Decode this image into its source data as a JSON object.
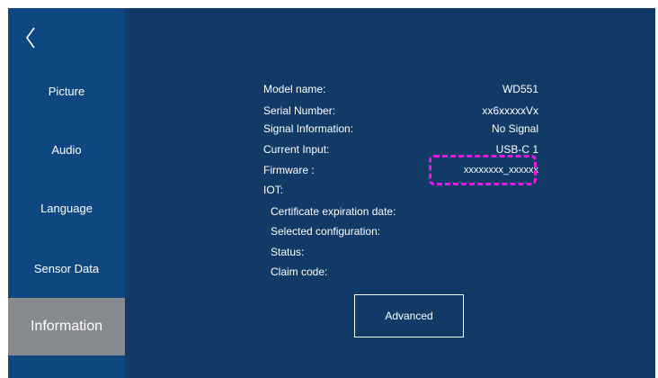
{
  "sidebar": {
    "back_icon": "chevron-left-icon",
    "items": [
      {
        "label": "Picture"
      },
      {
        "label": "Audio"
      },
      {
        "label": "Language"
      },
      {
        "label": "Sensor Data"
      },
      {
        "label": "Information",
        "active": true
      }
    ]
  },
  "info": {
    "model_name": {
      "label": "Model name:",
      "value": "WD551"
    },
    "serial_number": {
      "label": "Serial Number:",
      "value": "xx6xxxxxVx"
    },
    "signal_information": {
      "label": "Signal Information:",
      "value": "No Signal"
    },
    "current_input": {
      "label": "Current Input:",
      "value": "USB-C 1"
    },
    "firmware": {
      "label": "Firmware :",
      "value": "xxxxxxxx_xxxxxx"
    },
    "iot": {
      "label": "IOT:",
      "certificate_expiration_date": "Certificate expiration date:",
      "selected_configuration": "Selected configuration:",
      "status": "Status:",
      "claim_code": "Claim code:"
    }
  },
  "advanced_button": {
    "label": "Advanced"
  },
  "colors": {
    "background": "#113a67",
    "sidebar": "#0f4881",
    "active_item": "#878b90",
    "highlight": "#e21ae6",
    "text": "#ffffff"
  }
}
